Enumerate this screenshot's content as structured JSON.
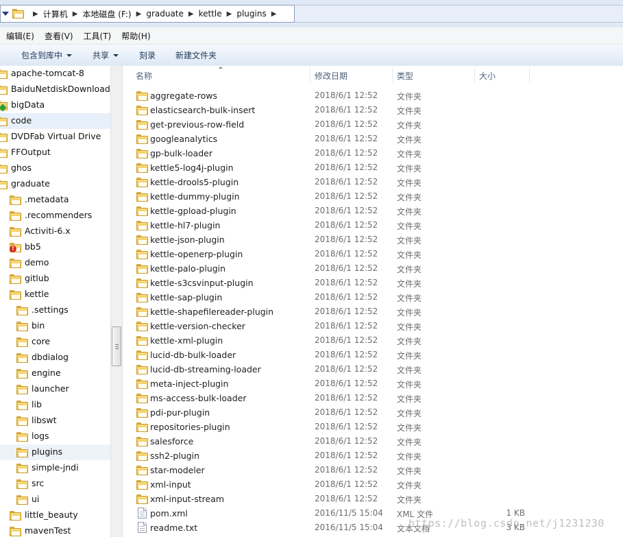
{
  "address": {
    "crumbs": [
      "计算机",
      "本地磁盘 (F:)",
      "graduate",
      "kettle",
      "plugins"
    ]
  },
  "menu": [
    "编辑(E)",
    "查看(V)",
    "工具(T)",
    "帮助(H)"
  ],
  "toolbar": {
    "include_library": "包含到库中",
    "share": "共享",
    "burn": "刻录",
    "new_folder": "新建文件夹"
  },
  "nav": [
    {
      "label": "apache-tomcat-8",
      "indent": 0
    },
    {
      "label": "BaiduNetdiskDownload",
      "indent": 0
    },
    {
      "label": "bigData",
      "indent": 0,
      "badge": "green"
    },
    {
      "label": "code",
      "indent": 0,
      "selected": true
    },
    {
      "label": "DVDFab Virtual Drive",
      "indent": 0
    },
    {
      "label": "FFOutput",
      "indent": 0
    },
    {
      "label": "ghos",
      "indent": 0
    },
    {
      "label": "graduate",
      "indent": 0
    },
    {
      "label": ".metadata",
      "indent": 1
    },
    {
      "label": ".recommenders",
      "indent": 1
    },
    {
      "label": "Activiti-6.x",
      "indent": 1
    },
    {
      "label": "bb5",
      "indent": 1,
      "badge": "red"
    },
    {
      "label": "demo",
      "indent": 1
    },
    {
      "label": "gitlub",
      "indent": 1
    },
    {
      "label": "kettle",
      "indent": 1
    },
    {
      "label": ".settings",
      "indent": 2
    },
    {
      "label": "bin",
      "indent": 2,
      "expand": true
    },
    {
      "label": "core",
      "indent": 2,
      "expand": true
    },
    {
      "label": "dbdialog",
      "indent": 2,
      "expand": true
    },
    {
      "label": "engine",
      "indent": 2,
      "expand": true
    },
    {
      "label": "launcher",
      "indent": 2
    },
    {
      "label": "lib",
      "indent": 2
    },
    {
      "label": "libswt",
      "indent": 2,
      "expand": true
    },
    {
      "label": "logs",
      "indent": 2
    },
    {
      "label": "plugins",
      "indent": 2,
      "expand": true,
      "highlight": true
    },
    {
      "label": "simple-jndi",
      "indent": 2
    },
    {
      "label": "src",
      "indent": 2
    },
    {
      "label": "ui",
      "indent": 2,
      "expand": true
    },
    {
      "label": "little_beauty",
      "indent": 1,
      "expand": true
    },
    {
      "label": "mavenTest",
      "indent": 1
    }
  ],
  "columns": {
    "name": "名称",
    "date": "修改日期",
    "type": "类型",
    "size": "大小"
  },
  "files": [
    {
      "name": "aggregate-rows",
      "date": "2018/6/1 12:52",
      "type": "文件夹",
      "size": "",
      "kind": "folder"
    },
    {
      "name": "elasticsearch-bulk-insert",
      "date": "2018/6/1 12:52",
      "type": "文件夹",
      "size": "",
      "kind": "folder"
    },
    {
      "name": "get-previous-row-field",
      "date": "2018/6/1 12:52",
      "type": "文件夹",
      "size": "",
      "kind": "folder"
    },
    {
      "name": "googleanalytics",
      "date": "2018/6/1 12:52",
      "type": "文件夹",
      "size": "",
      "kind": "folder"
    },
    {
      "name": "gp-bulk-loader",
      "date": "2018/6/1 12:52",
      "type": "文件夹",
      "size": "",
      "kind": "folder"
    },
    {
      "name": "kettle5-log4j-plugin",
      "date": "2018/6/1 12:52",
      "type": "文件夹",
      "size": "",
      "kind": "folder"
    },
    {
      "name": "kettle-drools5-plugin",
      "date": "2018/6/1 12:52",
      "type": "文件夹",
      "size": "",
      "kind": "folder"
    },
    {
      "name": "kettle-dummy-plugin",
      "date": "2018/6/1 12:52",
      "type": "文件夹",
      "size": "",
      "kind": "folder"
    },
    {
      "name": "kettle-gpload-plugin",
      "date": "2018/6/1 12:52",
      "type": "文件夹",
      "size": "",
      "kind": "folder"
    },
    {
      "name": "kettle-hl7-plugin",
      "date": "2018/6/1 12:52",
      "type": "文件夹",
      "size": "",
      "kind": "folder"
    },
    {
      "name": "kettle-json-plugin",
      "date": "2018/6/1 12:52",
      "type": "文件夹",
      "size": "",
      "kind": "folder"
    },
    {
      "name": "kettle-openerp-plugin",
      "date": "2018/6/1 12:52",
      "type": "文件夹",
      "size": "",
      "kind": "folder"
    },
    {
      "name": "kettle-palo-plugin",
      "date": "2018/6/1 12:52",
      "type": "文件夹",
      "size": "",
      "kind": "folder"
    },
    {
      "name": "kettle-s3csvinput-plugin",
      "date": "2018/6/1 12:52",
      "type": "文件夹",
      "size": "",
      "kind": "folder"
    },
    {
      "name": "kettle-sap-plugin",
      "date": "2018/6/1 12:52",
      "type": "文件夹",
      "size": "",
      "kind": "folder"
    },
    {
      "name": "kettle-shapefilereader-plugin",
      "date": "2018/6/1 12:52",
      "type": "文件夹",
      "size": "",
      "kind": "folder"
    },
    {
      "name": "kettle-version-checker",
      "date": "2018/6/1 12:52",
      "type": "文件夹",
      "size": "",
      "kind": "folder"
    },
    {
      "name": "kettle-xml-plugin",
      "date": "2018/6/1 12:52",
      "type": "文件夹",
      "size": "",
      "kind": "folder"
    },
    {
      "name": "lucid-db-bulk-loader",
      "date": "2018/6/1 12:52",
      "type": "文件夹",
      "size": "",
      "kind": "folder"
    },
    {
      "name": "lucid-db-streaming-loader",
      "date": "2018/6/1 12:52",
      "type": "文件夹",
      "size": "",
      "kind": "folder"
    },
    {
      "name": "meta-inject-plugin",
      "date": "2018/6/1 12:52",
      "type": "文件夹",
      "size": "",
      "kind": "folder"
    },
    {
      "name": "ms-access-bulk-loader",
      "date": "2018/6/1 12:52",
      "type": "文件夹",
      "size": "",
      "kind": "folder"
    },
    {
      "name": "pdi-pur-plugin",
      "date": "2018/6/1 12:52",
      "type": "文件夹",
      "size": "",
      "kind": "folder"
    },
    {
      "name": "repositories-plugin",
      "date": "2018/6/1 12:52",
      "type": "文件夹",
      "size": "",
      "kind": "folder"
    },
    {
      "name": "salesforce",
      "date": "2018/6/1 12:52",
      "type": "文件夹",
      "size": "",
      "kind": "folder"
    },
    {
      "name": "ssh2-plugin",
      "date": "2018/6/1 12:52",
      "type": "文件夹",
      "size": "",
      "kind": "folder"
    },
    {
      "name": "star-modeler",
      "date": "2018/6/1 12:52",
      "type": "文件夹",
      "size": "",
      "kind": "folder"
    },
    {
      "name": "xml-input",
      "date": "2018/6/1 12:52",
      "type": "文件夹",
      "size": "",
      "kind": "folder"
    },
    {
      "name": "xml-input-stream",
      "date": "2018/6/1 12:52",
      "type": "文件夹",
      "size": "",
      "kind": "folder"
    },
    {
      "name": "pom.xml",
      "date": "2016/11/5 15:04",
      "type": "XML 文件",
      "size": "1 KB",
      "kind": "file"
    },
    {
      "name": "readme.txt",
      "date": "2016/11/5 15:04",
      "type": "文本文档",
      "size": "3 KB",
      "kind": "file"
    }
  ],
  "watermark": "https://blog.csdn.net/j1231230"
}
